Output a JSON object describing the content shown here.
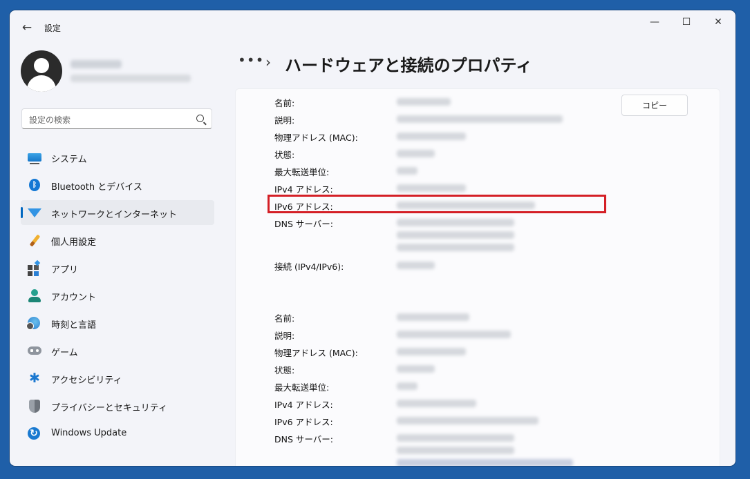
{
  "window": {
    "title": "設定",
    "controls": {
      "minimize": "—",
      "maximize": "☐",
      "close": "✕"
    },
    "back": "←"
  },
  "search": {
    "placeholder": "設定の検索"
  },
  "nav": [
    {
      "label": "システム",
      "icon": "system-icon"
    },
    {
      "label": "Bluetooth とデバイス",
      "icon": "bluetooth-icon"
    },
    {
      "label": "ネットワークとインターネット",
      "icon": "wifi-icon",
      "active": true
    },
    {
      "label": "個人用設定",
      "icon": "brush-icon"
    },
    {
      "label": "アプリ",
      "icon": "apps-icon"
    },
    {
      "label": "アカウント",
      "icon": "account-icon"
    },
    {
      "label": "時刻と言語",
      "icon": "globe-clock-icon"
    },
    {
      "label": "ゲーム",
      "icon": "gamepad-icon"
    },
    {
      "label": "アクセシビリティ",
      "icon": "accessibility-icon"
    },
    {
      "label": "プライバシーとセキュリティ",
      "icon": "shield-icon"
    },
    {
      "label": "Windows Update",
      "icon": "update-icon"
    }
  ],
  "breadcrumb": {
    "more": "•••",
    "separator": "›",
    "title": "ハードウェアと接続のプロパティ"
  },
  "copy_button": "コピー",
  "adapters": [
    {
      "labels": [
        "名前:",
        "説明:",
        "物理アドレス (MAC):",
        "状態:",
        "最大転送単位:",
        "IPv4 アドレス:",
        "IPv6 アドレス:",
        "DNS サーバー:",
        "接続 (IPv4/IPv6):"
      ]
    },
    {
      "labels": [
        "名前:",
        "説明:",
        "物理アドレス (MAC):",
        "状態:",
        "最大転送単位:",
        "IPv4 アドレス:",
        "IPv6 アドレス:",
        "DNS サーバー:"
      ]
    }
  ],
  "colors": {
    "accent": "#0067c0",
    "highlight": "#d41f26",
    "desktop": "#1f5fa8"
  }
}
